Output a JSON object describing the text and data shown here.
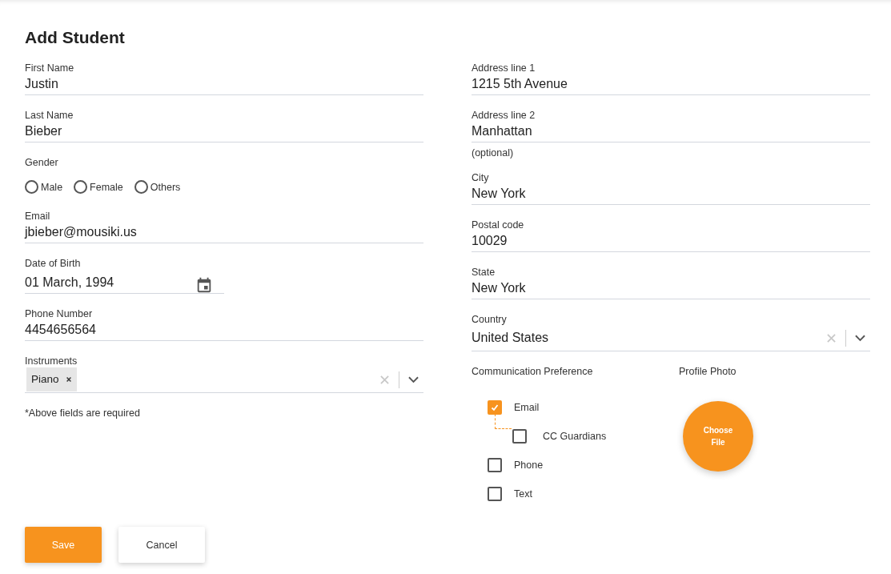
{
  "title": "Add Student",
  "left_fields": [
    {
      "kind": "text",
      "label": "First Name",
      "value": "Justin"
    },
    {
      "kind": "text",
      "label": "Last Name",
      "value": "Bieber"
    },
    {
      "kind": "radio",
      "label": "Gender",
      "options": [
        {
          "label": "Male",
          "selected": false
        },
        {
          "label": "Female",
          "selected": false
        },
        {
          "label": "Others",
          "selected": false
        }
      ]
    },
    {
      "kind": "text",
      "label": "Email",
      "value": "jbieber@mousiki.us"
    },
    {
      "kind": "date",
      "label": "Date of Birth",
      "value": "01 March, 1994"
    },
    {
      "kind": "text",
      "label": "Phone Number",
      "value": "4454656564"
    },
    {
      "kind": "multiselect",
      "label": "Instruments",
      "tags": [
        "Piano"
      ]
    }
  ],
  "required_note": "*Above fields are required",
  "right_fields": [
    {
      "kind": "text",
      "label": "Address line 1",
      "value": "1215 5th Avenue"
    },
    {
      "kind": "text",
      "label": "Address line 2",
      "value": "Manhattan",
      "hint": "(optional)"
    },
    {
      "kind": "text",
      "label": "City",
      "value": "New York"
    },
    {
      "kind": "text",
      "label": "Postal code",
      "value": "10029"
    },
    {
      "kind": "text",
      "label": "State",
      "value": "New York"
    },
    {
      "kind": "select",
      "label": "Country",
      "value": "United States"
    }
  ],
  "communication_preference": {
    "label": "Communication Preference",
    "options": [
      {
        "label": "Email",
        "checked": true,
        "children": [
          {
            "label": "CC Guardians",
            "checked": false
          }
        ]
      },
      {
        "label": "Phone",
        "checked": false
      },
      {
        "label": "Text",
        "checked": false
      }
    ]
  },
  "profile_photo": {
    "label": "Profile Photo",
    "button": "Choose File"
  },
  "buttons": [
    {
      "kind": "primary",
      "label": "Save"
    },
    {
      "kind": "secondary",
      "label": "Cancel"
    }
  ]
}
